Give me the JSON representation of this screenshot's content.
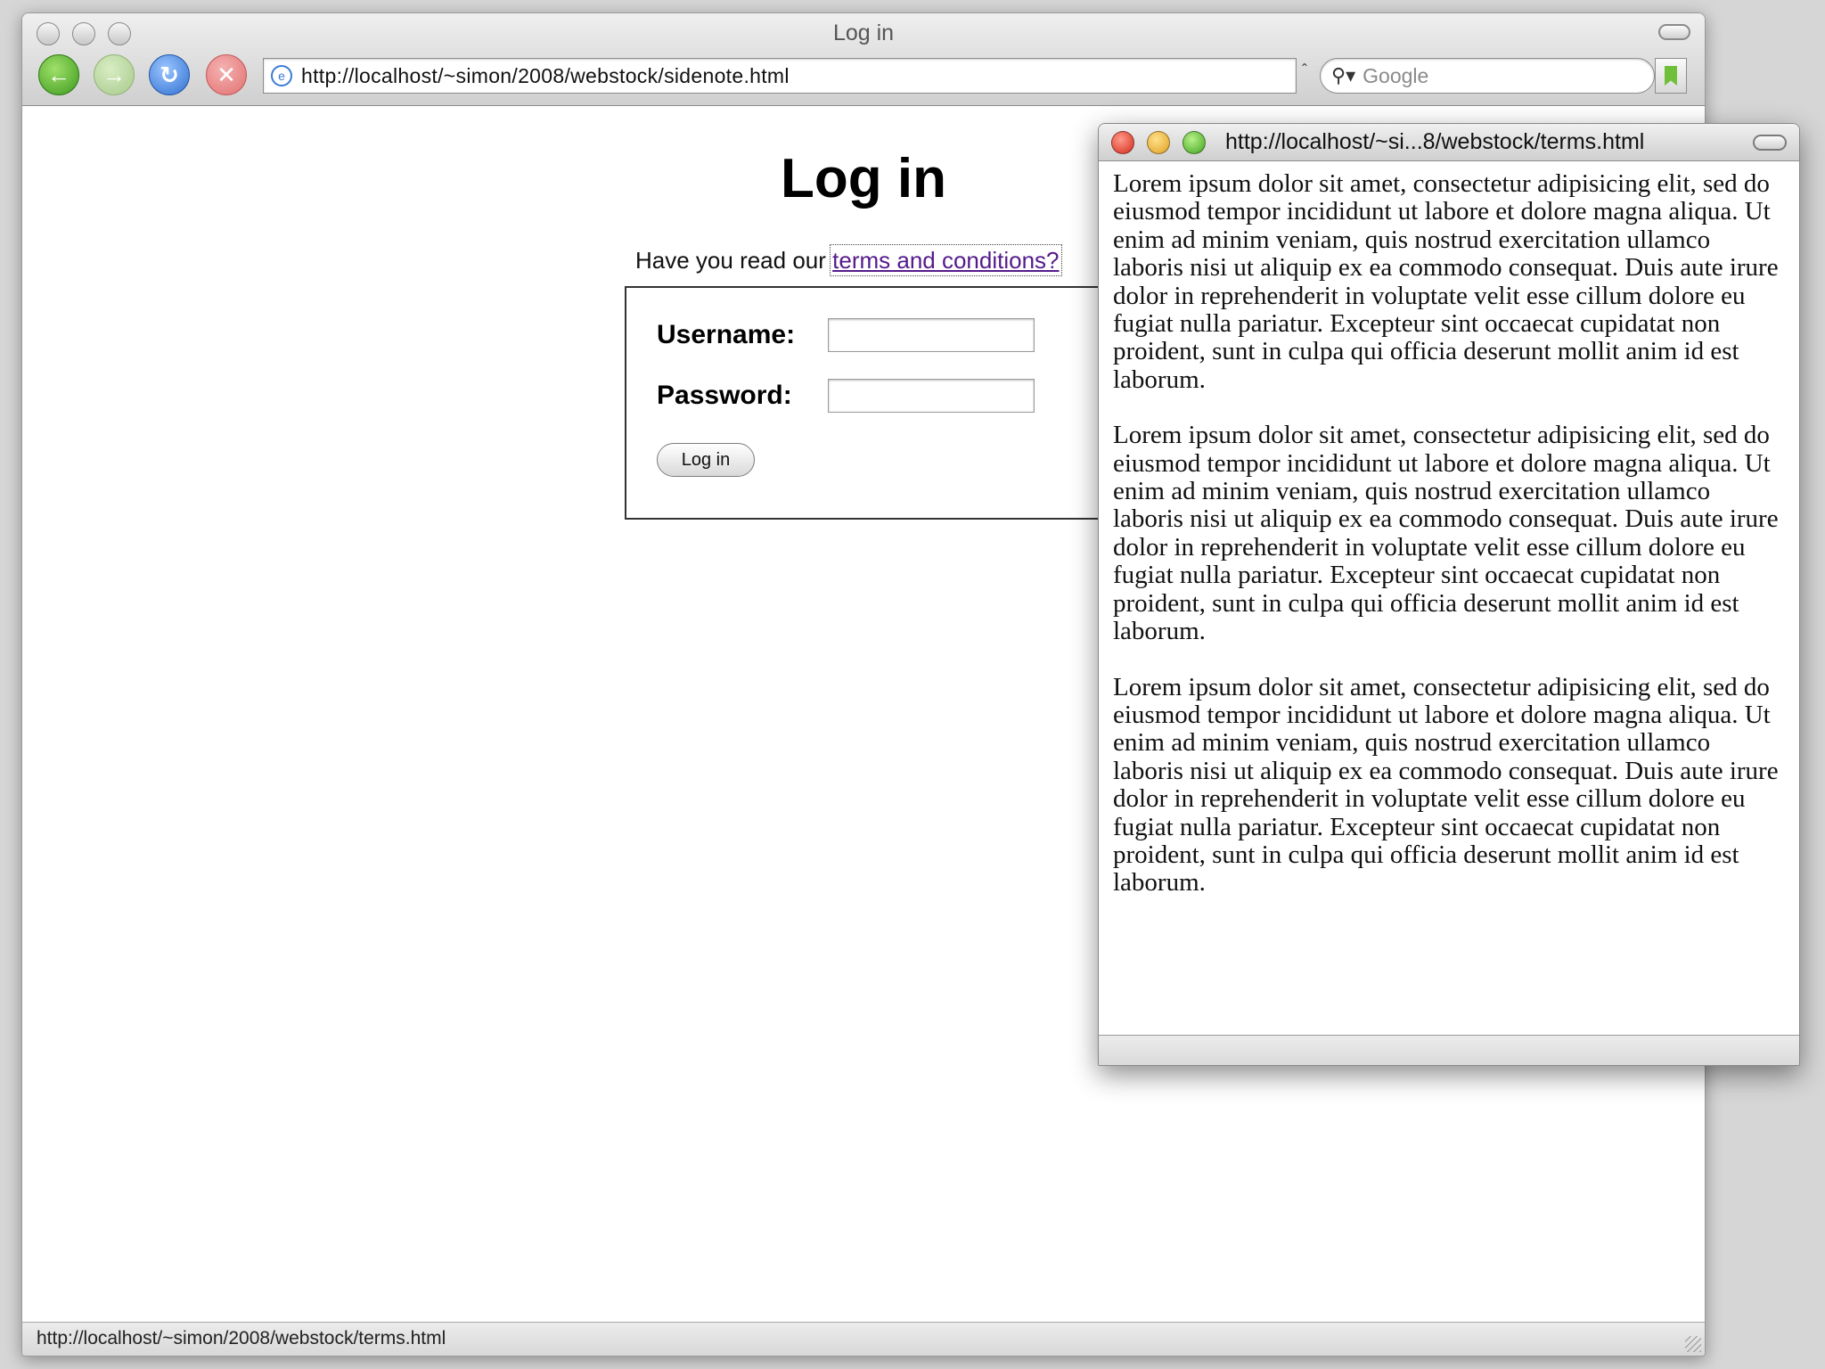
{
  "browser": {
    "window_title": "Log in",
    "url": "http://localhost/~simon/2008/webstock/sidenote.html",
    "search_placeholder": "Google",
    "status_text": "http://localhost/~simon/2008/webstock/terms.html"
  },
  "page": {
    "heading": "Log in",
    "intro_prefix": "Have you read our ",
    "terms_link": "terms and conditions?",
    "username_label": "Username:",
    "password_label": "Password:",
    "username_value": "",
    "password_value": "",
    "login_button": "Log in"
  },
  "popup": {
    "title": "http://localhost/~si...8/webstock/terms.html",
    "paragraphs": [
      "Lorem ipsum dolor sit amet, consectetur adipisicing elit, sed do eiusmod tempor incididunt ut labore et dolore magna aliqua. Ut enim ad minim veniam, quis nostrud exercitation ullamco laboris nisi ut aliquip ex ea commodo consequat. Duis aute irure dolor in reprehenderit in voluptate velit esse cillum dolore eu fugiat nulla pariatur. Excepteur sint occaecat cupidatat non proident, sunt in culpa qui officia deserunt mollit anim id est laborum.",
      "Lorem ipsum dolor sit amet, consectetur adipisicing elit, sed do eiusmod tempor incididunt ut labore et dolore magna aliqua. Ut enim ad minim veniam, quis nostrud exercitation ullamco laboris nisi ut aliquip ex ea commodo consequat. Duis aute irure dolor in reprehenderit in voluptate velit esse cillum dolore eu fugiat nulla pariatur. Excepteur sint occaecat cupidatat non proident, sunt in culpa qui officia deserunt mollit anim id est laborum.",
      "Lorem ipsum dolor sit amet, consectetur adipisicing elit, sed do eiusmod tempor incididunt ut labore et dolore magna aliqua. Ut enim ad minim veniam, quis nostrud exercitation ullamco laboris nisi ut aliquip ex ea commodo consequat. Duis aute irure dolor in reprehenderit in voluptate velit esse cillum dolore eu fugiat nulla pariatur. Excepteur sint occaecat cupidatat non proident, sunt in culpa qui officia deserunt mollit anim id est laborum."
    ]
  },
  "icons": {
    "back": "back-arrow-icon",
    "forward": "forward-arrow-icon",
    "reload": "reload-icon",
    "stop": "stop-icon",
    "search": "search-icon",
    "bookmark": "bookmark-icon"
  },
  "colors": {
    "link": "#551a8b",
    "close": "#d42a1a",
    "minimize": "#e0a020",
    "zoom": "#3fa51e"
  }
}
